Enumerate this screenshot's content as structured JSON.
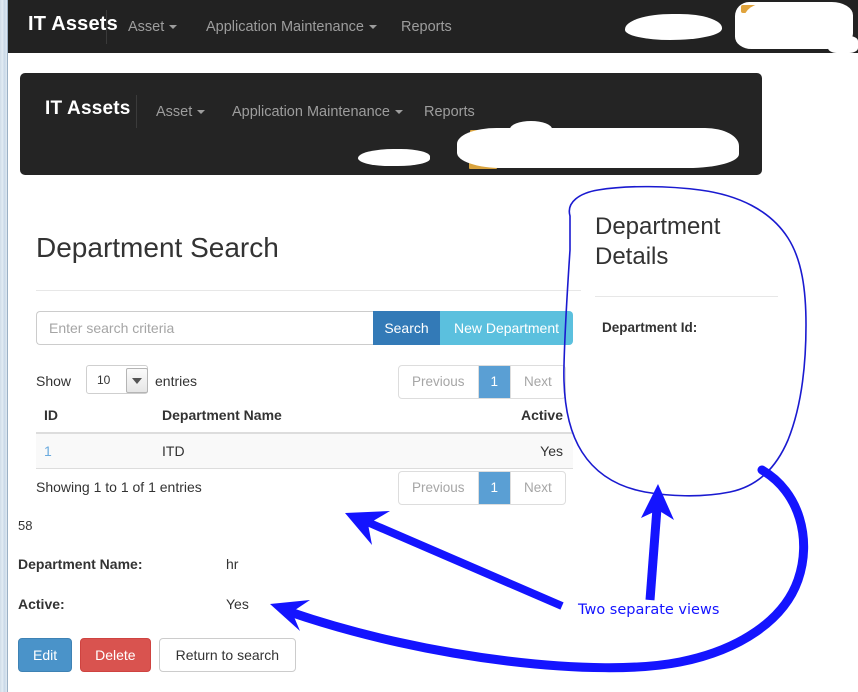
{
  "outer_navbar": {
    "brand": "IT Assets",
    "items": [
      {
        "label": "Asset",
        "has_caret": true
      },
      {
        "label": "Application Maintenance",
        "has_caret": true
      },
      {
        "label": "Reports",
        "has_caret": false
      }
    ]
  },
  "inner_navbar": {
    "brand": "IT Assets",
    "items": [
      {
        "label": "Asset",
        "has_caret": true
      },
      {
        "label": "Application Maintenance",
        "has_caret": true
      },
      {
        "label": "Reports",
        "has_caret": false
      }
    ]
  },
  "search_view": {
    "title": "Department Search",
    "search_placeholder": "Enter search criteria",
    "search_value": "",
    "search_button": "Search",
    "new_department_button": "New Department",
    "length_show_label": "Show",
    "length_value": "10",
    "length_entries_label": "entries",
    "pagination": {
      "previous": "Previous",
      "page": "1",
      "next": "Next"
    },
    "table": {
      "headers": [
        "ID",
        "Department Name",
        "Active"
      ],
      "rows": [
        {
          "id": "1",
          "name": "ITD",
          "active": "Yes"
        }
      ]
    },
    "info": "Showing 1 to 1 of 1 entries"
  },
  "detail_view": {
    "id_value": "58",
    "name_label": "Department Name:",
    "name_value": "hr",
    "active_label": "Active:",
    "active_value": "Yes",
    "edit_button": "Edit",
    "delete_button": "Delete",
    "return_button": "Return to search"
  },
  "details_panel": {
    "title": "Department Details",
    "department_id_label": "Department Id:"
  },
  "annotation": {
    "note": "Two separate views",
    "color": "#1414ff"
  },
  "colors": {
    "navbar_bg": "#222222",
    "inner_navbar_bg": "#242424",
    "primary_button": "#337ab7",
    "info_button": "#5bc0de",
    "edit_button": "#4a93c9",
    "delete_button": "#d9534f",
    "pager_active": "#5a9fd4",
    "link": "#6aaade",
    "annotation": "#1414ff"
  }
}
